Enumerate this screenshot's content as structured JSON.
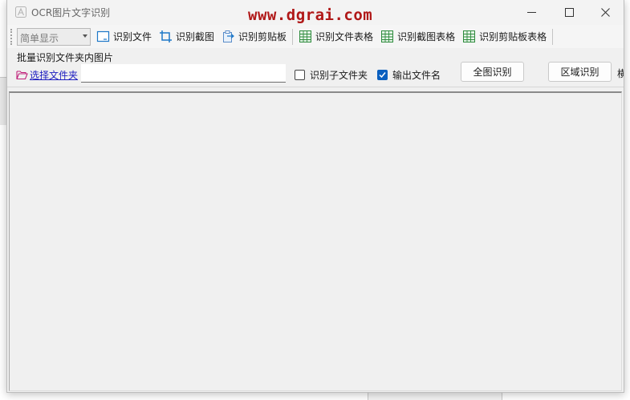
{
  "window": {
    "title": "OCR图片文字识别",
    "watermark": "www.dgrai.com",
    "controls": [
      "minimize",
      "maximize",
      "close"
    ]
  },
  "toolbar": {
    "mode_select": {
      "value": "简单显示"
    },
    "buttons": [
      {
        "label": "识别文件",
        "icon": "file-icon"
      },
      {
        "label": "识别截图",
        "icon": "crop-icon"
      },
      {
        "label": "识别剪贴板",
        "icon": "clipboard-icon"
      },
      {
        "label": "识别文件表格",
        "icon": "table-icon"
      },
      {
        "label": "识别截图表格",
        "icon": "table-icon"
      },
      {
        "label": "识别剪贴板表格",
        "icon": "table-icon"
      }
    ]
  },
  "batch": {
    "group_label": "批量识别文件夹内图片",
    "select_folder_label": "选择文件夹",
    "folder_path": "",
    "include_subfolders": {
      "label": "识别子文件夹",
      "checked": false
    },
    "output_filename": {
      "label": "输出文件名",
      "checked": true
    },
    "full_image_button": "全图识别",
    "region_button": "区域识别",
    "truncated_label": "横"
  },
  "colors": {
    "watermark": "#b01818",
    "link": "#2020c0",
    "checkbox_on": "#0a5fbf",
    "table_icon": "#2e8b3d",
    "file_icon": "#1e78c8"
  }
}
